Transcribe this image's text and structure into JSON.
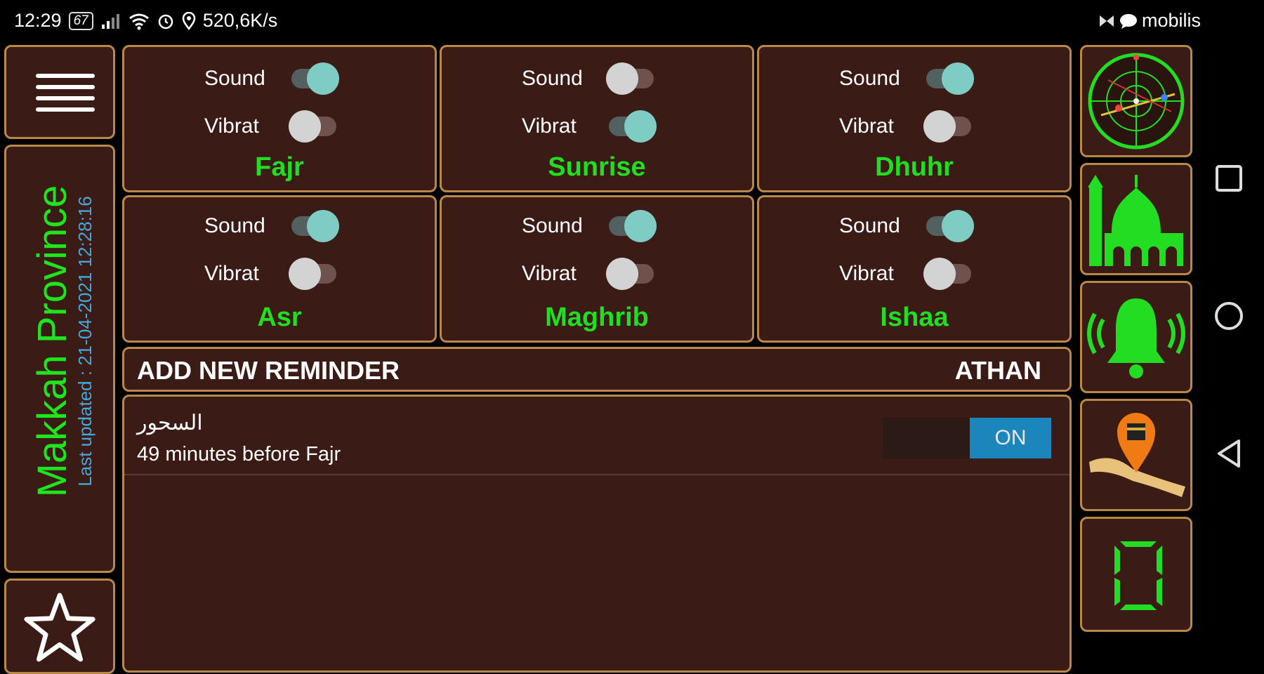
{
  "status_bar": {
    "time": "12:29",
    "battery": "67",
    "network_speed": "520,6K/s",
    "carrier": "mobilis"
  },
  "sidebar": {
    "location": "Makkah Province",
    "last_updated": "Last updated : 21-04-2021 12:28:16"
  },
  "prayers": [
    {
      "name": "Fajr",
      "sound_label": "Sound",
      "vibrate_label": "Vibrat",
      "sound": true,
      "vibrate": false
    },
    {
      "name": "Sunrise",
      "sound_label": "Sound",
      "vibrate_label": "Vibrat",
      "sound": false,
      "vibrate": true
    },
    {
      "name": "Dhuhr",
      "sound_label": "Sound",
      "vibrate_label": "Vibrat",
      "sound": true,
      "vibrate": false
    },
    {
      "name": "Asr",
      "sound_label": "Sound",
      "vibrate_label": "Vibrat",
      "sound": true,
      "vibrate": false
    },
    {
      "name": "Maghrib",
      "sound_label": "Sound",
      "vibrate_label": "Vibrat",
      "sound": true,
      "vibrate": false
    },
    {
      "name": "Ishaa",
      "sound_label": "Sound",
      "vibrate_label": "Vibrat",
      "sound": true,
      "vibrate": false
    }
  ],
  "reminder_bar": {
    "add_label": "ADD NEW REMINDER",
    "athan_label": "ATHAN"
  },
  "reminders": [
    {
      "title": "السحور",
      "subtitle": "49 minutes before Fajr",
      "toggle_label": "ON",
      "enabled": true
    }
  ],
  "right_icons": [
    "qibla-compass-icon",
    "mosque-icon",
    "bell-icon",
    "location-map-icon",
    "counter-zero-icon"
  ],
  "colors": {
    "background": "#3a1b16",
    "border": "#b8894a",
    "prayer_name": "#22dd22",
    "accent_blue": "#1a86bb",
    "toggle_on": "#7fccc4",
    "updated_text": "#44a8dc"
  }
}
